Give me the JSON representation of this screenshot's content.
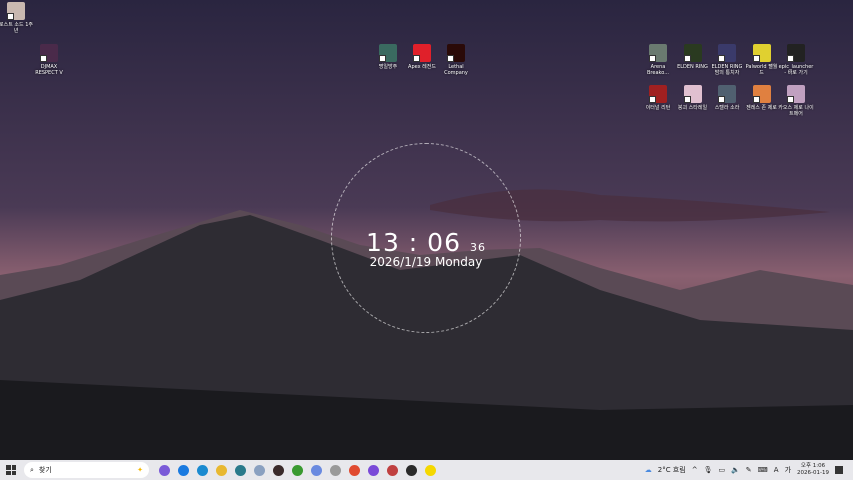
{
  "desktop": {
    "icons_left": [
      {
        "label": "로스트 소드 1주년",
        "color": "#c9b8b0"
      },
      {
        "label": "DJMAX RESPECT V",
        "color": "#4a2a4a"
      }
    ],
    "icons_mid": [
      {
        "label": "명일방주",
        "color": "#3a6a60"
      },
      {
        "label": "Apex 레전드",
        "color": "#e0202a"
      },
      {
        "label": "Lethal Company",
        "color": "#2a0a08"
      }
    ],
    "icons_right": [
      {
        "label": "Arena Breako...",
        "color": "#6a7a70"
      },
      {
        "label": "ELDEN RING",
        "color": "#2a3a20"
      },
      {
        "label": "ELDEN RING 밤의 통치자",
        "color": "#3a3a6a"
      },
      {
        "label": "Palworld 팰월드",
        "color": "#e0d030"
      },
      {
        "label": "epic_launcher - 바로 가기",
        "color": "#222222"
      },
      {
        "label": "이터널 리턴",
        "color": "#a02020"
      },
      {
        "label": "붕괴 스타레일",
        "color": "#e0c0d0"
      },
      {
        "label": "스텔라 소라",
        "color": "#506070"
      },
      {
        "label": "젠레스 존 제로",
        "color": "#e08040"
      },
      {
        "label": "카오스 제로 나이트메어",
        "color": "#c0a0c0"
      }
    ]
  },
  "clock": {
    "time": "13 : 06",
    "seconds": "36",
    "date": "2026/1/19 Monday"
  },
  "taskbar": {
    "search_placeholder": "찾기",
    "apps": [
      {
        "name": "copilot",
        "color": "#7a5ad8"
      },
      {
        "name": "app-blue",
        "color": "#1a7ae0"
      },
      {
        "name": "edge",
        "color": "#1a8ad0"
      },
      {
        "name": "file-explorer",
        "color": "#e8b830"
      },
      {
        "name": "store",
        "color": "#2a7a8a"
      },
      {
        "name": "snipping",
        "color": "#8aa0c0"
      },
      {
        "name": "media-player",
        "color": "#3a2a2a"
      },
      {
        "name": "minecraft",
        "color": "#3a9a30"
      },
      {
        "name": "wiki",
        "color": "#6a8ae0"
      },
      {
        "name": "app-gray",
        "color": "#9a9a9a"
      },
      {
        "name": "chrome",
        "color": "#e04a30"
      },
      {
        "name": "app-purple",
        "color": "#7a4ad8"
      },
      {
        "name": "chrome-profile",
        "color": "#c04040"
      },
      {
        "name": "app-dark",
        "color": "#2a2a2a"
      },
      {
        "name": "kakaotalk",
        "color": "#f5d800"
      }
    ],
    "weather": "2°C 흐림",
    "time": "오후 1:06",
    "date": "2026-01-19"
  }
}
